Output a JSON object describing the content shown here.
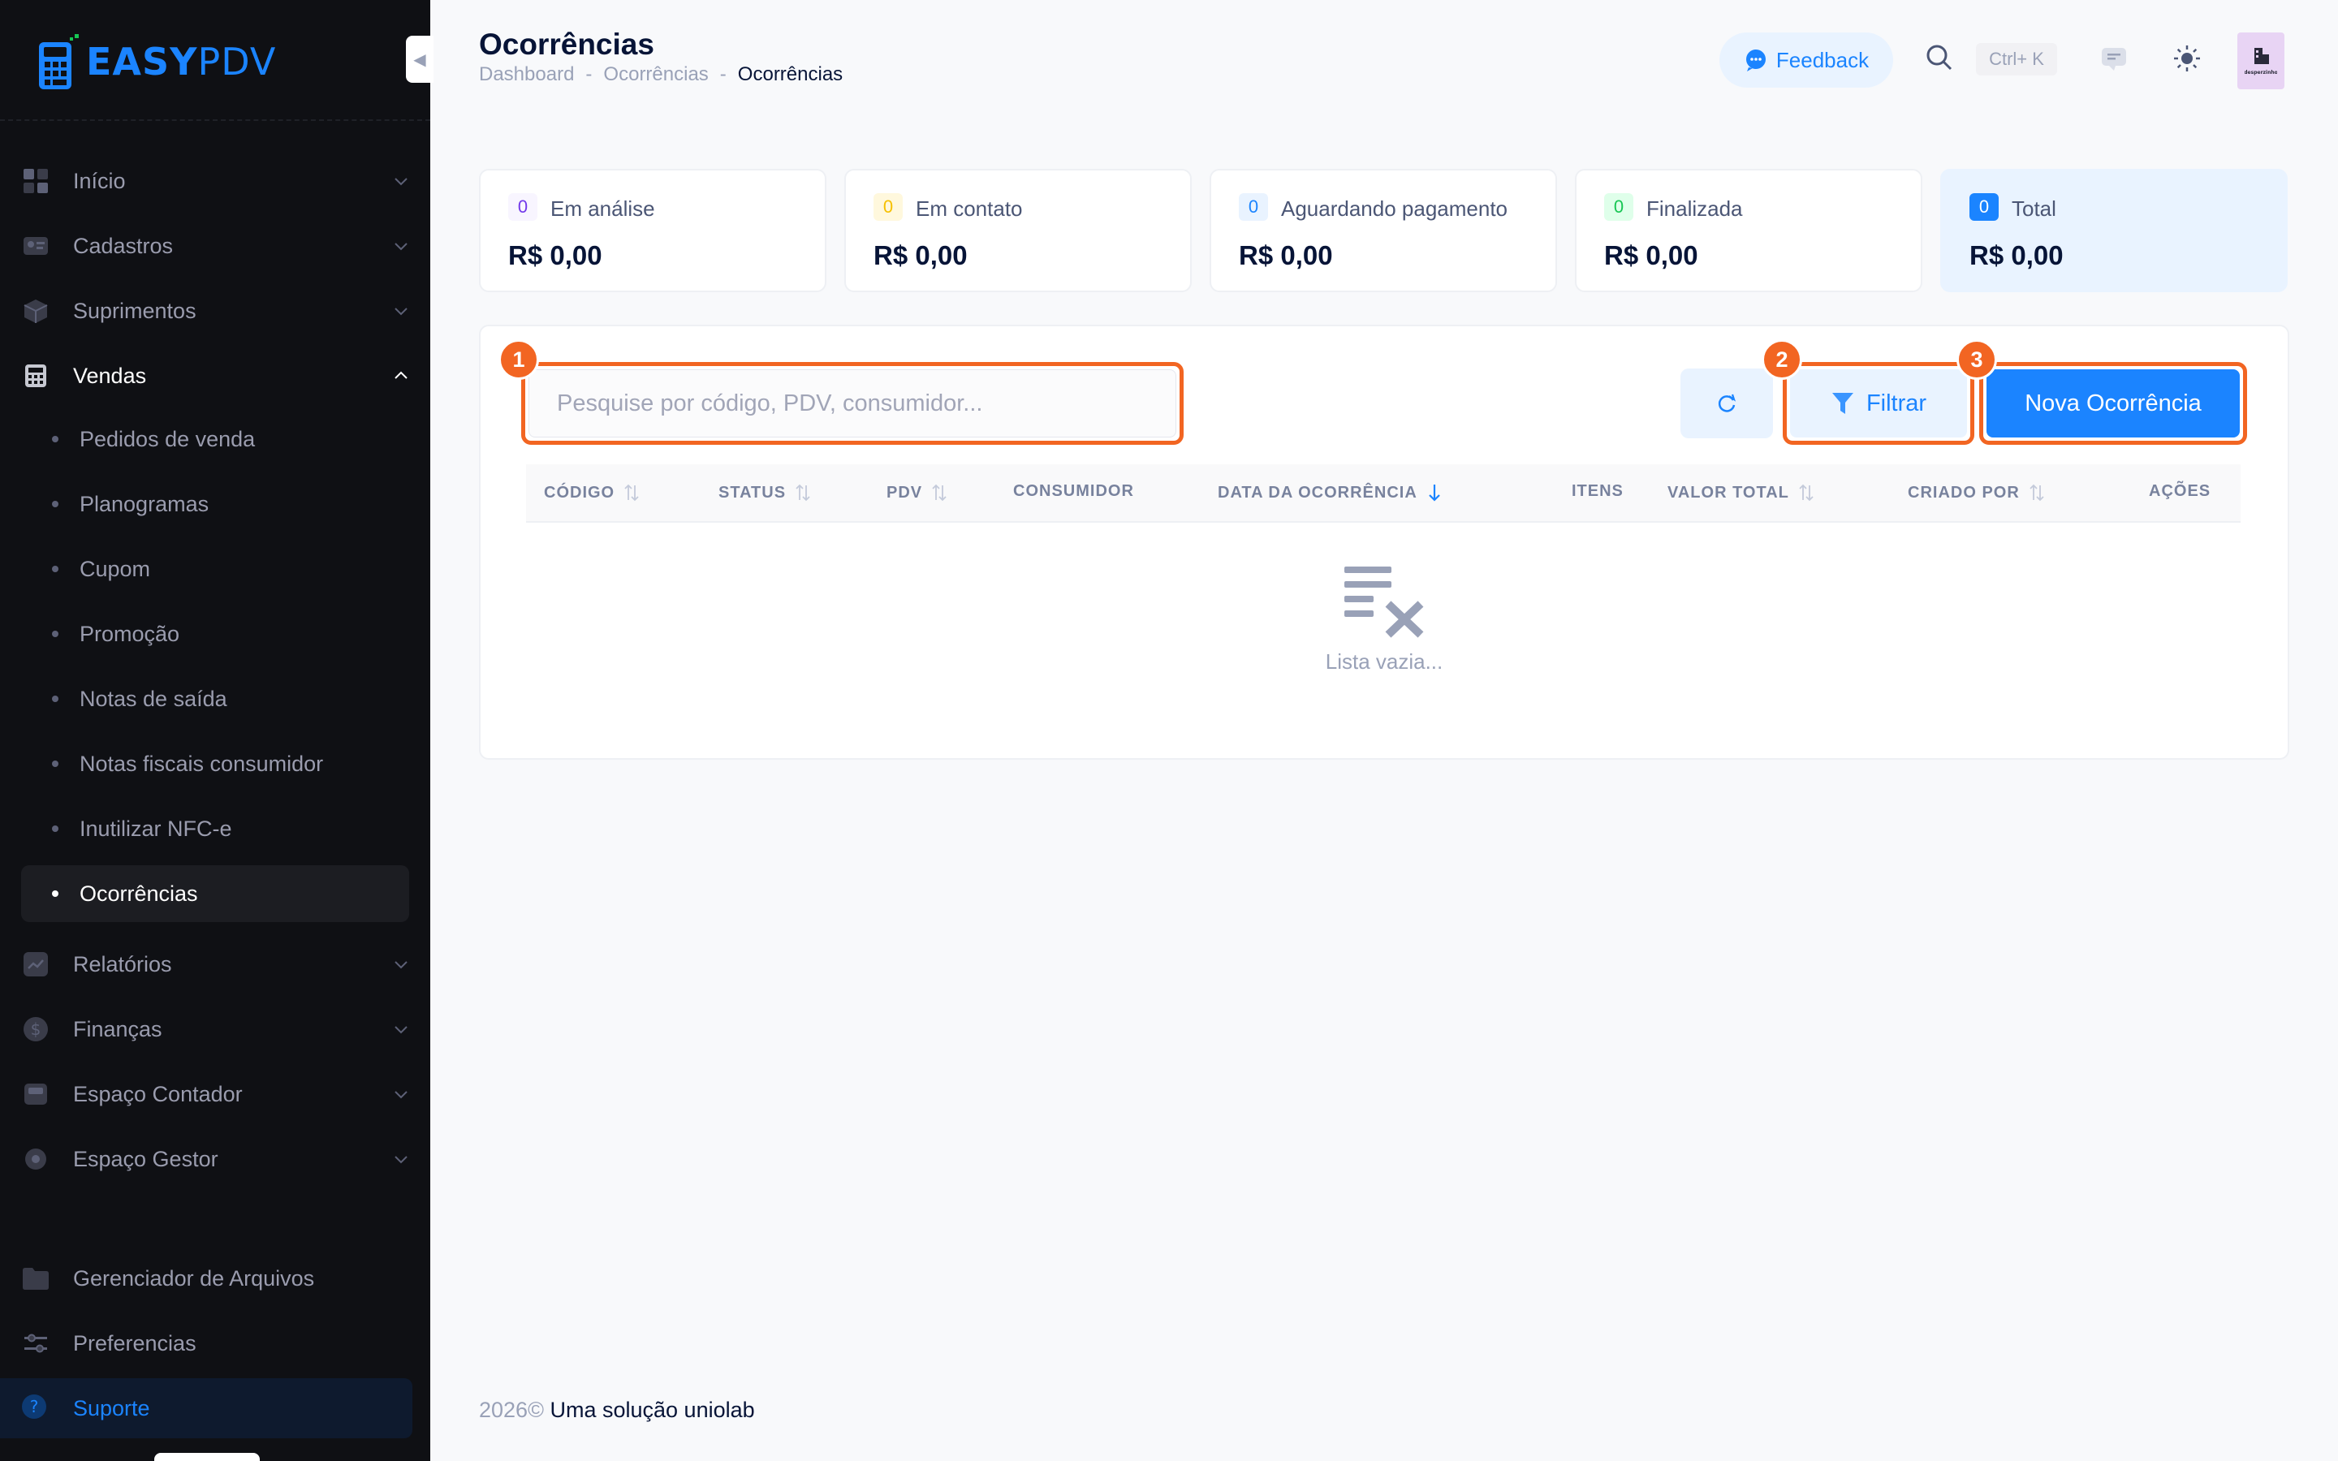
{
  "app": {
    "logo_text_easy": "EASY",
    "logo_text_pdv": "PDV"
  },
  "sidebar": {
    "items": [
      {
        "label": "Início",
        "icon": "grid-icon"
      },
      {
        "label": "Cadastros",
        "icon": "id-card-icon"
      },
      {
        "label": "Suprimentos",
        "icon": "box-icon"
      },
      {
        "label": "Vendas",
        "icon": "calculator-icon"
      },
      {
        "label": "Relatórios",
        "icon": "chart-line-icon"
      },
      {
        "label": "Finanças",
        "icon": "dollar-icon"
      },
      {
        "label": "Espaço Contador",
        "icon": "monitor-icon"
      },
      {
        "label": "Espaço Gestor",
        "icon": "settings-icon"
      },
      {
        "label": "Gerenciador de Arquivos",
        "icon": "folder-icon"
      },
      {
        "label": "Preferencias",
        "icon": "sliders-icon"
      },
      {
        "label": "Suporte",
        "icon": "help-icon"
      }
    ],
    "vendas_sub": [
      "Pedidos de venda",
      "Planogramas",
      "Cupom",
      "Promoção",
      "Notas de saída",
      "Notas fiscais consumidor",
      "Inutilizar NFC-e",
      "Ocorrências"
    ]
  },
  "header": {
    "title": "Ocorrências",
    "breadcrumb": [
      "Dashboard",
      "Ocorrências",
      "Ocorrências"
    ],
    "breadcrumb_sep": "-",
    "feedback_label": "Feedback",
    "shortcut": "Ctrl+ K",
    "avatar_text": "desperzinho"
  },
  "stats": [
    {
      "count": "0",
      "label": "Em análise",
      "value": "R$ 0,00",
      "color": "#7239ea"
    },
    {
      "count": "0",
      "label": "Em contato",
      "value": "R$ 0,00",
      "color": "#f6c000"
    },
    {
      "count": "0",
      "label": "Aguardando pagamento",
      "value": "R$ 0,00",
      "color": "#1b84ff"
    },
    {
      "count": "0",
      "label": "Finalizada",
      "value": "R$ 0,00",
      "color": "#17c653"
    },
    {
      "count": "0",
      "label": "Total",
      "value": "R$ 0,00",
      "color": "#1b84ff"
    }
  ],
  "toolbar": {
    "search_placeholder": "Pesquise por código, PDV, consumidor...",
    "filter_label": "Filtrar",
    "new_label": "Nova Ocorrência",
    "markers": [
      "1",
      "2",
      "3"
    ],
    "marker_color": "#f26522"
  },
  "table": {
    "columns": [
      "CÓDIGO",
      "STATUS",
      "PDV",
      "CONSUMIDOR",
      "DATA DA OCORRÊNCIA",
      "ITENS",
      "VALOR TOTAL",
      "CRIADO POR",
      "AÇÕES"
    ],
    "empty_text": "Lista vazia..."
  },
  "footer": {
    "year": "2026©",
    "text": "Uma solução uniolab"
  }
}
